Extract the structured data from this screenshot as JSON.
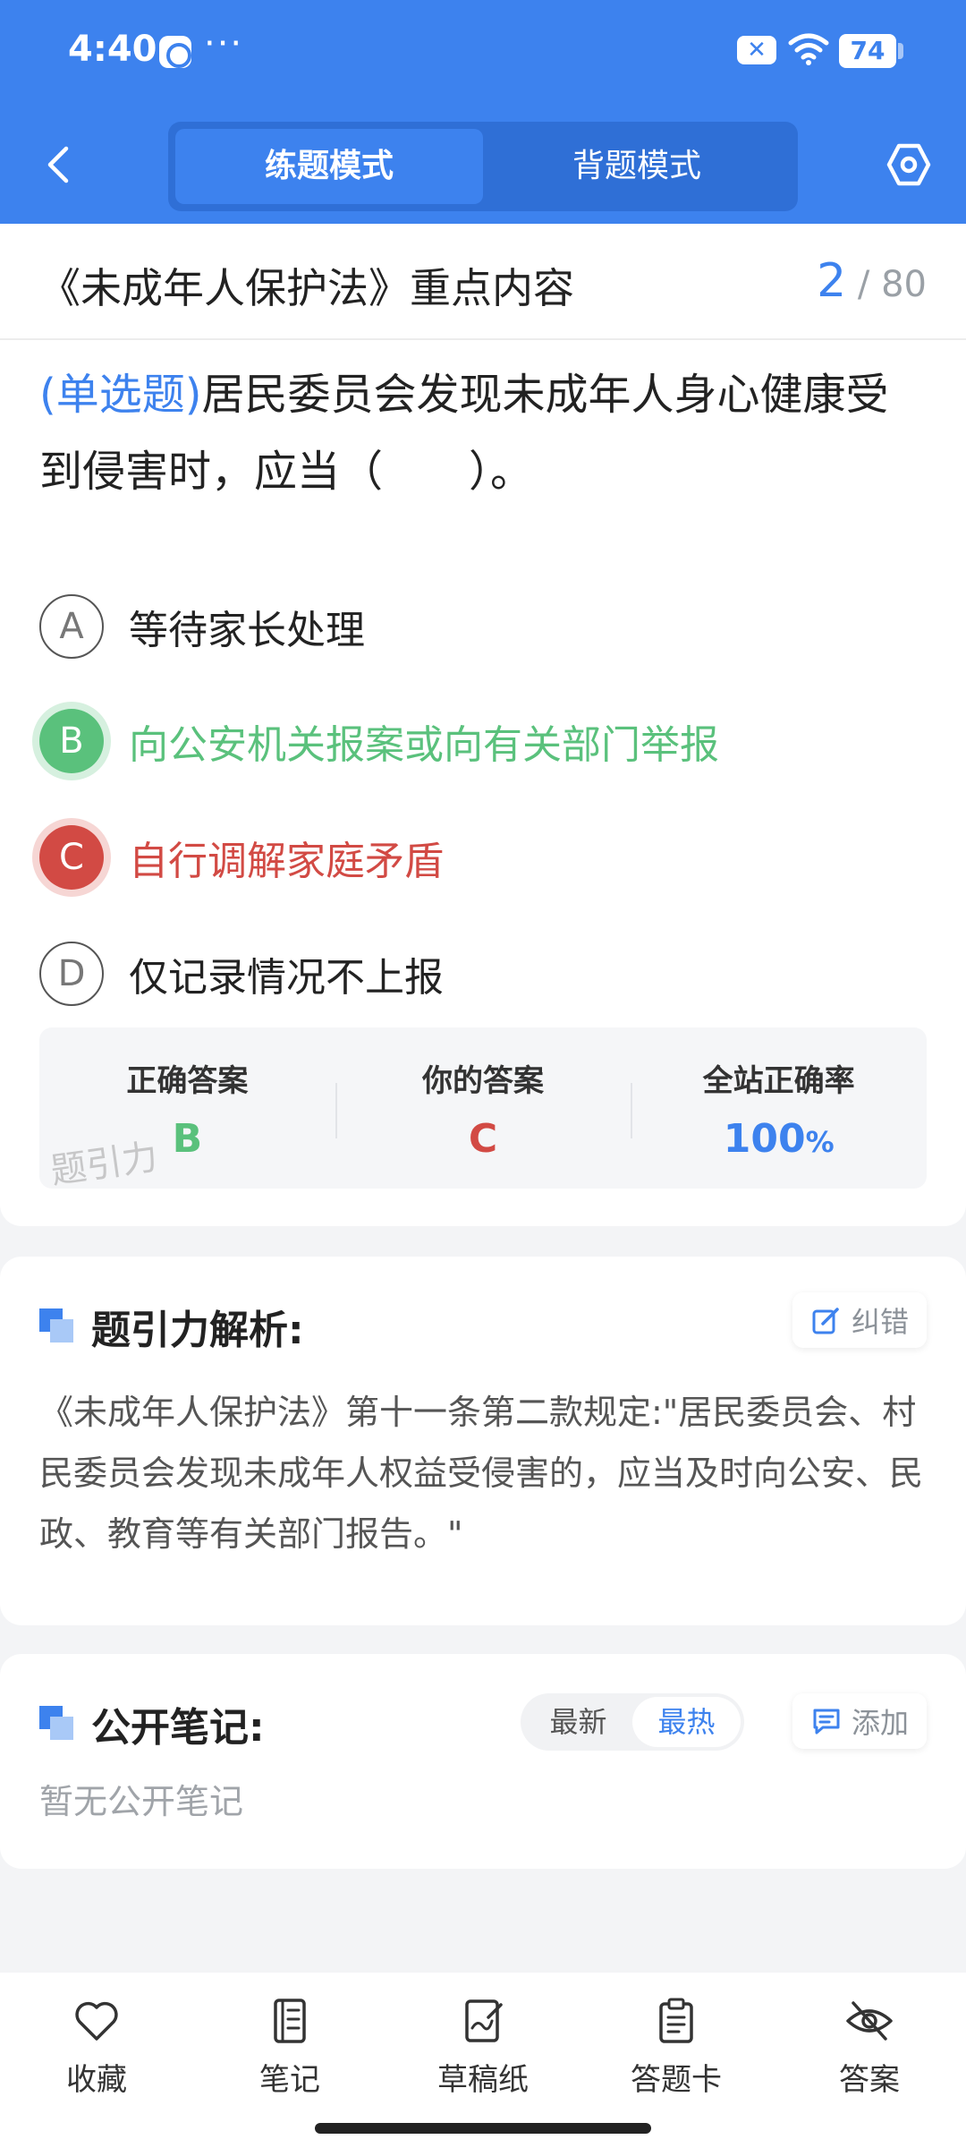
{
  "status_bar": {
    "time": "4:40",
    "dots": "···",
    "x_badge": "✕",
    "battery": "74"
  },
  "header": {
    "tabs": [
      {
        "label": "练题模式",
        "active": true
      },
      {
        "label": "背题模式",
        "active": false
      }
    ],
    "accent_color": "#3d82ee"
  },
  "chapter": {
    "title": "《未成年人保护法》重点内容",
    "current": "2",
    "separator": "/",
    "total": "80"
  },
  "question": {
    "type": "(单选题)",
    "text": "居民委员会发现未成年人身心健康受到侵害时，应当（　　）。",
    "options": [
      {
        "letter": "A",
        "text": "等待家长处理",
        "state": "normal"
      },
      {
        "letter": "B",
        "text": "向公安机关报案或向有关部门举报",
        "state": "correct"
      },
      {
        "letter": "C",
        "text": "自行调解家庭矛盾",
        "state": "wrong"
      },
      {
        "letter": "D",
        "text": "仅记录情况不上报",
        "state": "normal"
      }
    ]
  },
  "answer": {
    "correct_label": "正确答案",
    "correct_value": "B",
    "yours_label": "你的答案",
    "yours_value": "C",
    "rate_label": "全站正确率",
    "rate_value": "100",
    "rate_unit": "%",
    "watermark": "题引力"
  },
  "analysis": {
    "heading": "题引力解析:",
    "report_button": "纠错",
    "text": "《未成年人保护法》第十一条第二款规定:\"居民委员会、村民委员会发现未成年人权益受侵害的，应当及时向公安、民政、教育等有关部门报告。\""
  },
  "notes": {
    "heading": "公开笔记:",
    "sort_latest": "最新",
    "sort_hot": "最热",
    "add_button": "添加",
    "empty": "暂无公开笔记"
  },
  "bottom_nav": [
    {
      "label": "收藏",
      "icon": "heart-icon"
    },
    {
      "label": "笔记",
      "icon": "notebook-icon"
    },
    {
      "label": "草稿纸",
      "icon": "draft-icon"
    },
    {
      "label": "答题卡",
      "icon": "clipboard-icon"
    },
    {
      "label": "答案",
      "icon": "eye-off-icon"
    }
  ]
}
